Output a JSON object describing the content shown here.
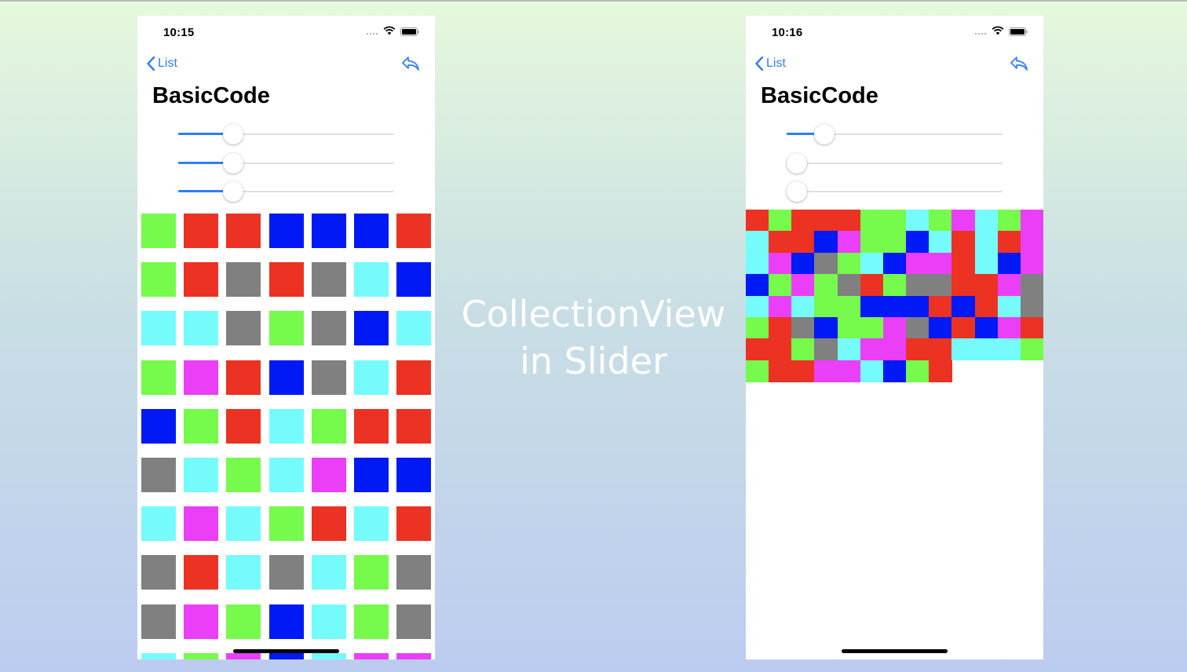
{
  "caption": {
    "line1": "CollectionView",
    "line2": "in Slider"
  },
  "colors": {
    "G": "#76fa4b",
    "R": "#eb3223",
    "B": "#0019f5",
    "C": "#76fbfd",
    "K": "#808080",
    "M": "#ea3ff7",
    "accent": "#2f7ef6"
  },
  "screens": [
    {
      "time": "10:15",
      "back_label": "List",
      "title": "BasicCode",
      "sliders": [
        0.23,
        0.23,
        0.23
      ],
      "icons": [
        "chevron-left-icon",
        "reply-icon",
        "wifi-icon",
        "battery-icon",
        "signal-icon"
      ],
      "grid": [
        [
          "G",
          "R",
          "R",
          "B",
          "B",
          "B",
          "R"
        ],
        [
          "G",
          "R",
          "K",
          "R",
          "K",
          "C",
          "B"
        ],
        [
          "C",
          "C",
          "K",
          "G",
          "K",
          "B",
          "C"
        ],
        [
          "G",
          "M",
          "R",
          "B",
          "K",
          "C",
          "R"
        ],
        [
          "B",
          "G",
          "R",
          "C",
          "G",
          "R",
          "R"
        ],
        [
          "K",
          "C",
          "G",
          "C",
          "M",
          "B",
          "B"
        ],
        [
          "C",
          "M",
          "C",
          "G",
          "R",
          "C",
          "R"
        ],
        [
          "K",
          "R",
          "C",
          "K",
          "C",
          "G",
          "K"
        ],
        [
          "K",
          "M",
          "G",
          "B",
          "C",
          "G",
          "K"
        ],
        [
          "C",
          "G",
          "M",
          "B",
          "C",
          "M",
          "M"
        ]
      ]
    },
    {
      "time": "10:16",
      "back_label": "List",
      "title": "BasicCode",
      "sliders": [
        0.14,
        0.0,
        0.0
      ],
      "icons": [
        "chevron-left-icon",
        "reply-icon",
        "wifi-icon",
        "battery-icon",
        "signal-icon"
      ],
      "grid": [
        [
          "R",
          "G",
          "R",
          "R",
          "R",
          "G",
          "G",
          "C",
          "G",
          "M",
          "C",
          "G",
          "M"
        ],
        [
          "C",
          "R",
          "R",
          "B",
          "M",
          "G",
          "G",
          "B",
          "C",
          "R",
          "C",
          "R",
          "M"
        ],
        [
          "C",
          "M",
          "B",
          "K",
          "G",
          "C",
          "B",
          "M",
          "M",
          "R",
          "C",
          "B",
          "M"
        ],
        [
          "B",
          "G",
          "M",
          "G",
          "K",
          "R",
          "G",
          "K",
          "K",
          "R",
          "R",
          "M",
          "K"
        ],
        [
          "C",
          "M",
          "C",
          "G",
          "G",
          "B",
          "B",
          "B",
          "R",
          "B",
          "R",
          "C",
          "K"
        ],
        [
          "G",
          "R",
          "K",
          "B",
          "G",
          "G",
          "M",
          "K",
          "B",
          "R",
          "B",
          "M",
          "R"
        ],
        [
          "R",
          "R",
          "G",
          "K",
          "C",
          "M",
          "M",
          "R",
          "R",
          "C",
          "C",
          "C",
          "G"
        ],
        [
          "G",
          "R",
          "R",
          "M",
          "M",
          "C",
          "B",
          "G",
          "R",
          "",
          "",
          "",
          ""
        ]
      ]
    }
  ]
}
